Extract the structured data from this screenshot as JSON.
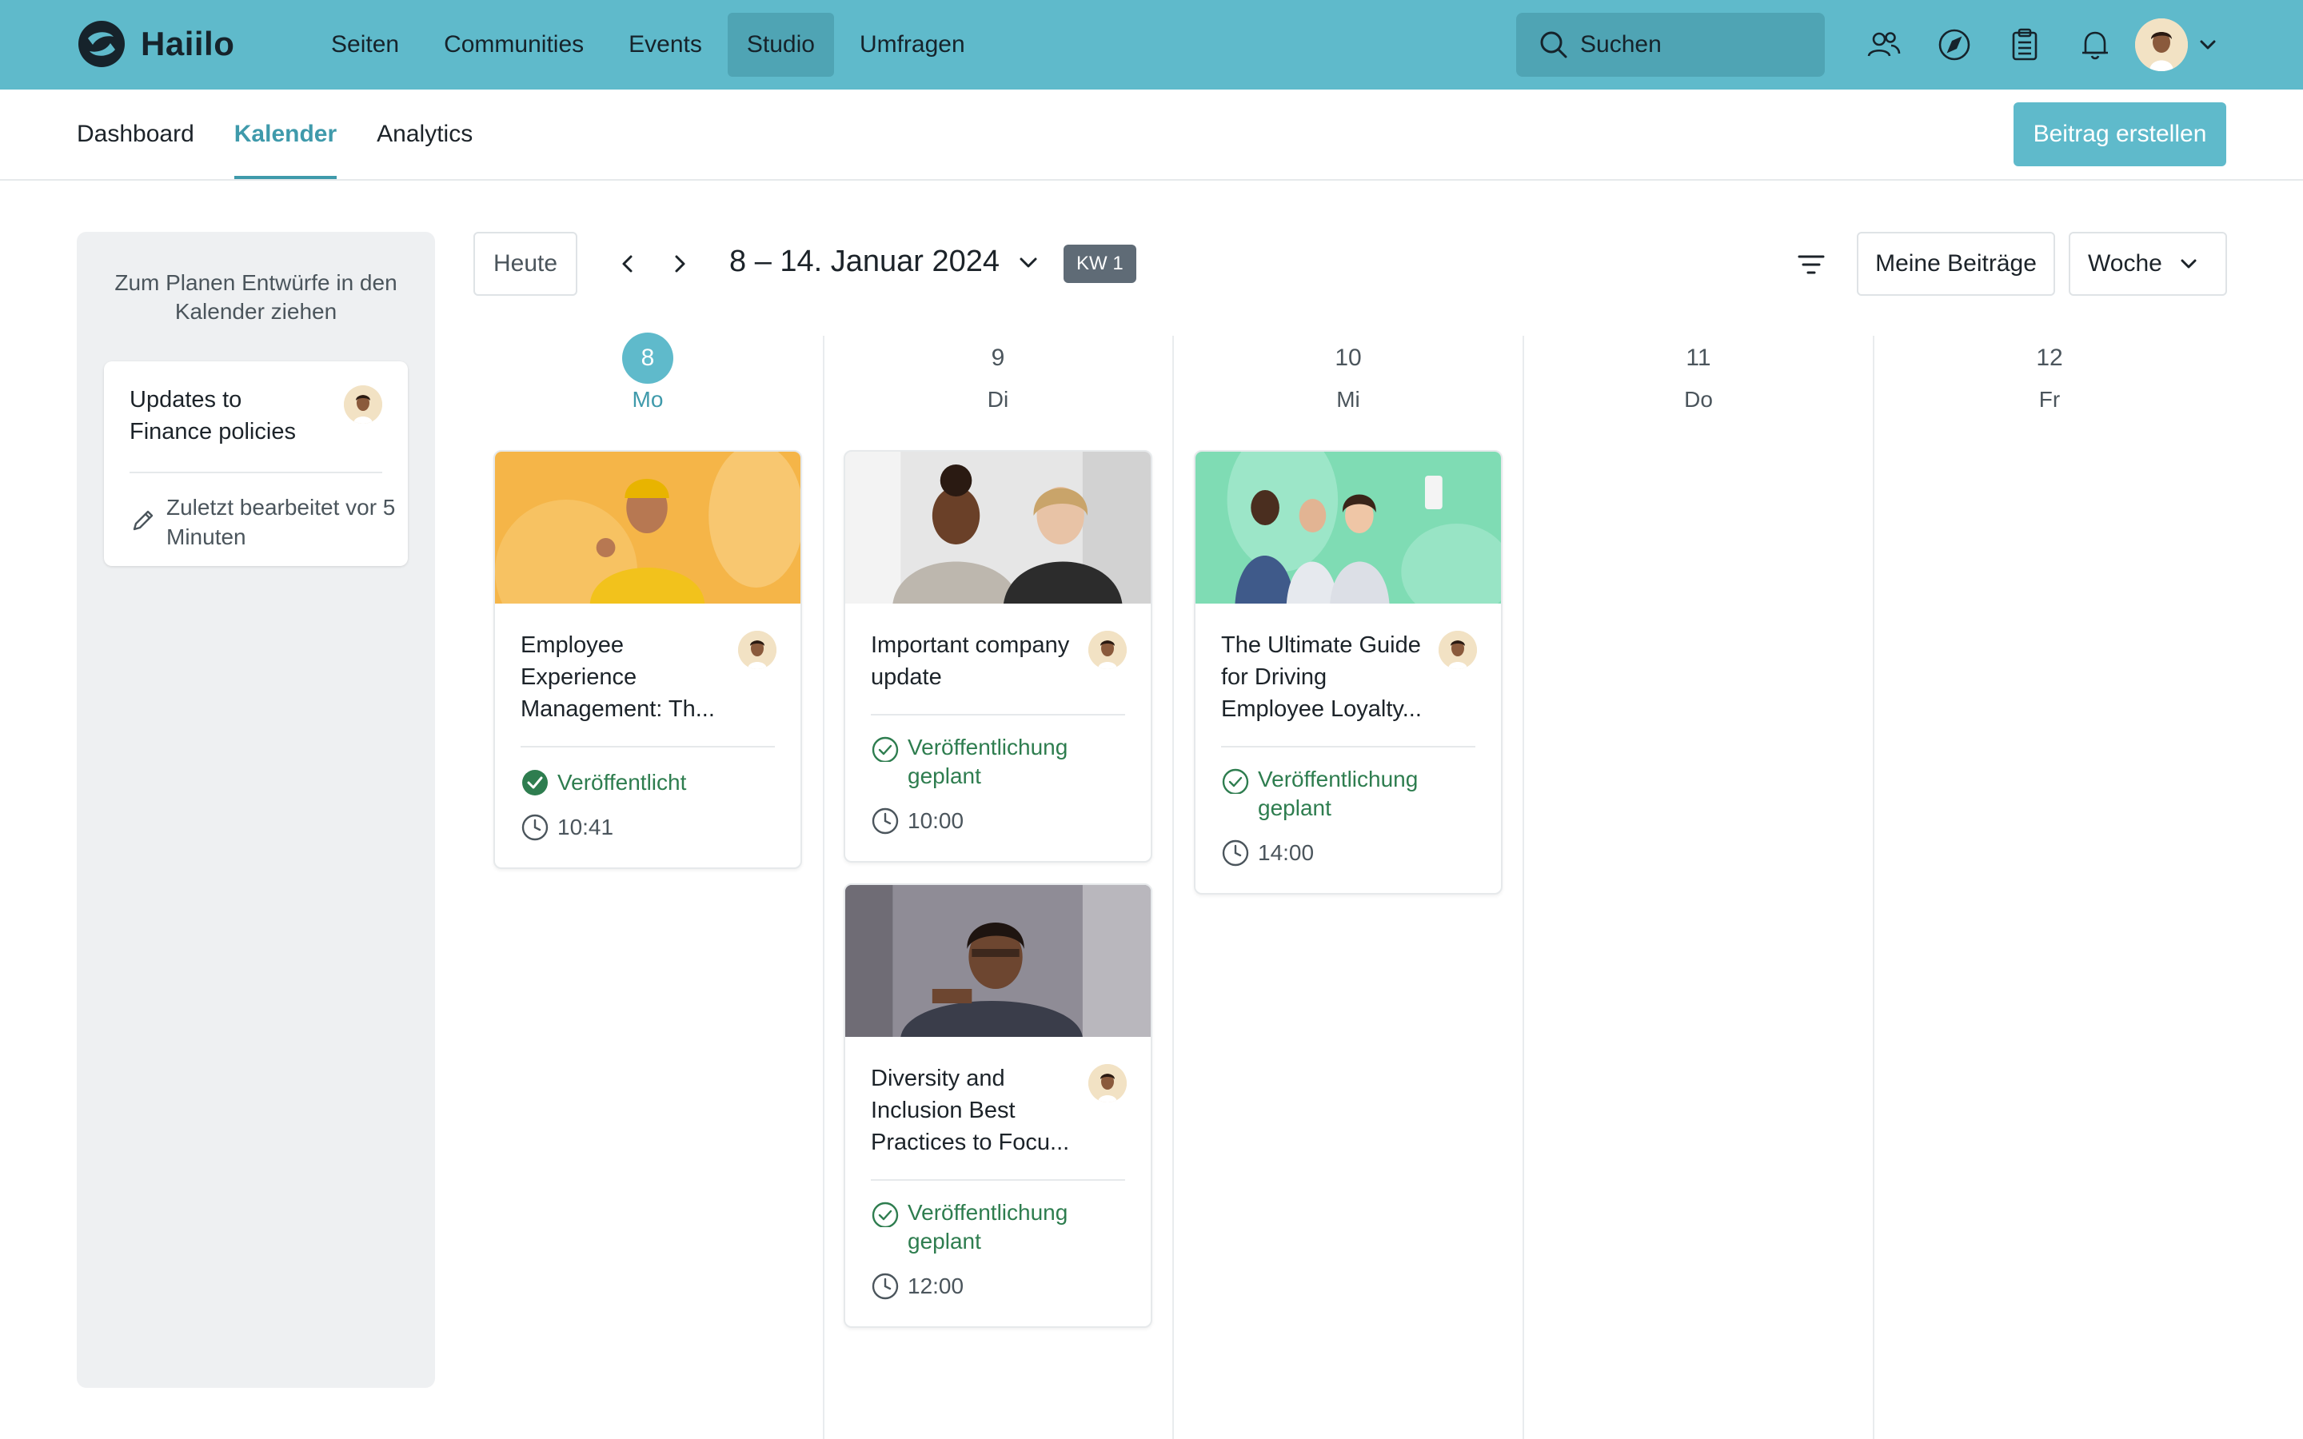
{
  "app": {
    "name": "Haiilo"
  },
  "main_nav": [
    "Seiten",
    "Communities",
    "Events",
    "Studio",
    "Umfragen"
  ],
  "search": {
    "placeholder": "Suchen"
  },
  "topbar_icons": [
    "people-icon",
    "compass-icon",
    "clipboard-icon",
    "bell-icon"
  ],
  "sub_nav": {
    "tabs": [
      "Dashboard",
      "Kalender",
      "Analytics"
    ],
    "active": "Kalender",
    "create_label": "Beitrag erstellen"
  },
  "drafts": {
    "hint": "Zum Planen Entwürfe in den Kalender ziehen",
    "items": [
      {
        "title": "Updates to Finance policies",
        "edited": "Zuletzt bearbeitet vor 5 Minuten"
      }
    ]
  },
  "toolbar": {
    "today": "Heute",
    "range": "8 – 14. Januar 2024",
    "week_badge": "KW 1",
    "mine": "Meine Beiträge",
    "view": "Woche"
  },
  "days": [
    {
      "num": "8",
      "name": "Mo",
      "today": true
    },
    {
      "num": "9",
      "name": "Di"
    },
    {
      "num": "10",
      "name": "Mi"
    },
    {
      "num": "11",
      "name": "Do"
    },
    {
      "num": "12",
      "name": "Fr"
    }
  ],
  "posts": [
    {
      "day": "8",
      "title": "Employee Experience Management: Th...",
      "status": "Veröffentlicht",
      "time": "10:41"
    },
    {
      "day": "9",
      "title": "Important company update",
      "status": "Veröffentlichung geplant",
      "time": "10:00"
    },
    {
      "day": "9",
      "title": "Diversity and Inclusion Best Practices to Focu...",
      "status": "Veröffentlichung geplant",
      "time": "12:00"
    },
    {
      "day": "10",
      "title": "The Ultimate Guide for Driving Employee Loyalty...",
      "status": "Veröffentlichung geplant",
      "time": "14:00"
    }
  ],
  "colors": {
    "brand": "#5fbacb",
    "brand_dark": "#3f9aab",
    "success": "#2e7d4f"
  }
}
